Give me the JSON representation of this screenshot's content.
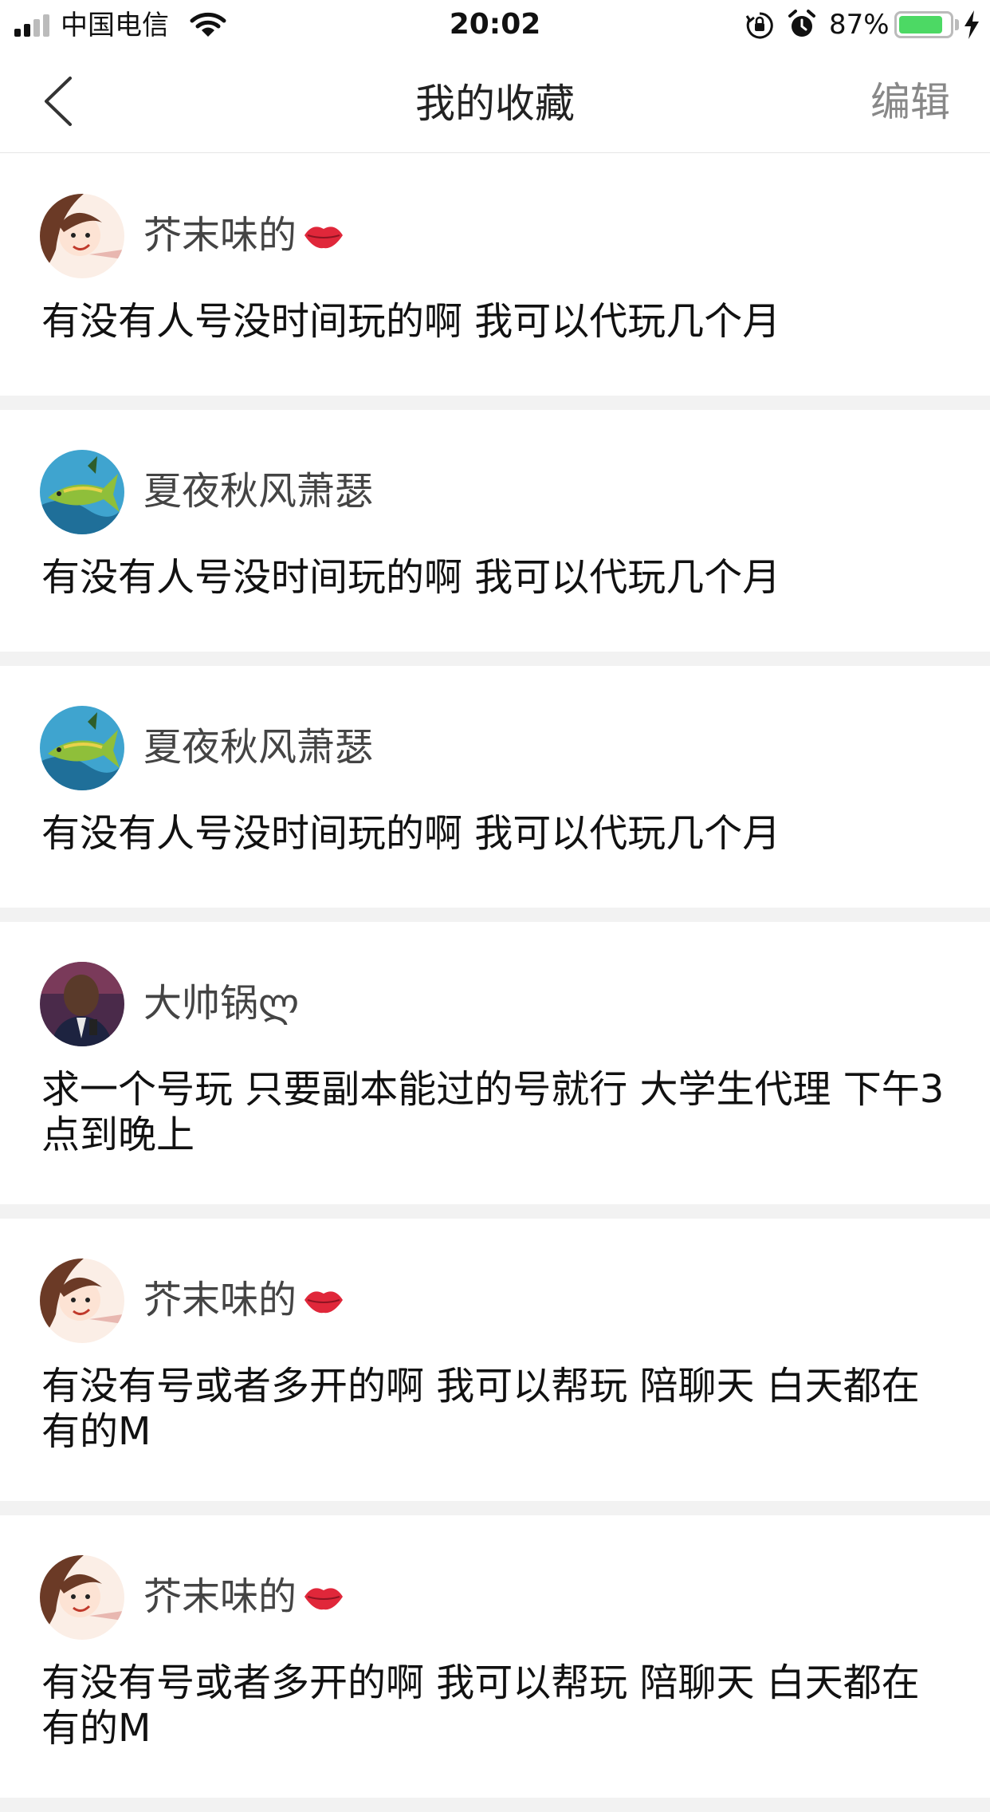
{
  "status_bar": {
    "carrier": "中国电信",
    "time": "20:02",
    "battery_percent": "87%",
    "battery_level": 0.87,
    "icons": [
      "signal-icon",
      "wifi-icon",
      "rotation-lock-icon",
      "alarm-icon",
      "battery-icon",
      "charging-icon"
    ]
  },
  "nav": {
    "back_icon": "back-chevron-icon",
    "title": "我的收藏",
    "edit_label": "编辑"
  },
  "colors": {
    "separator": "#f2f2f2",
    "battery_green": "#4cd964",
    "edit_gray": "#888888"
  },
  "items": [
    {
      "username": "芥末味的",
      "emoji": "lips-icon",
      "avatar": "girl-cartoon-avatar",
      "text": "有没有人号没时间玩的啊 我可以代玩几个月"
    },
    {
      "username": "夏夜秋风萧瑟",
      "emoji": "",
      "avatar": "fish-water-avatar",
      "text": "有没有人号没时间玩的啊 我可以代玩几个月"
    },
    {
      "username": "夏夜秋风萧瑟",
      "emoji": "",
      "avatar": "fish-water-avatar",
      "text": "有没有人号没时间玩的啊 我可以代玩几个月"
    },
    {
      "username": "大帅锅ლ",
      "emoji": "",
      "avatar": "man-photo-avatar",
      "text": "求一个号玩 只要副本能过的号就行 大学生代理 下午3点到晚上"
    },
    {
      "username": "芥末味的",
      "emoji": "lips-icon",
      "avatar": "girl-cartoon-avatar",
      "text": "有没有号或者多开的啊 我可以帮玩 陪聊天 白天都在有的M"
    },
    {
      "username": "芥末味的",
      "emoji": "lips-icon",
      "avatar": "girl-cartoon-avatar",
      "text": "有没有号或者多开的啊 我可以帮玩 陪聊天 白天都在有的M"
    }
  ]
}
